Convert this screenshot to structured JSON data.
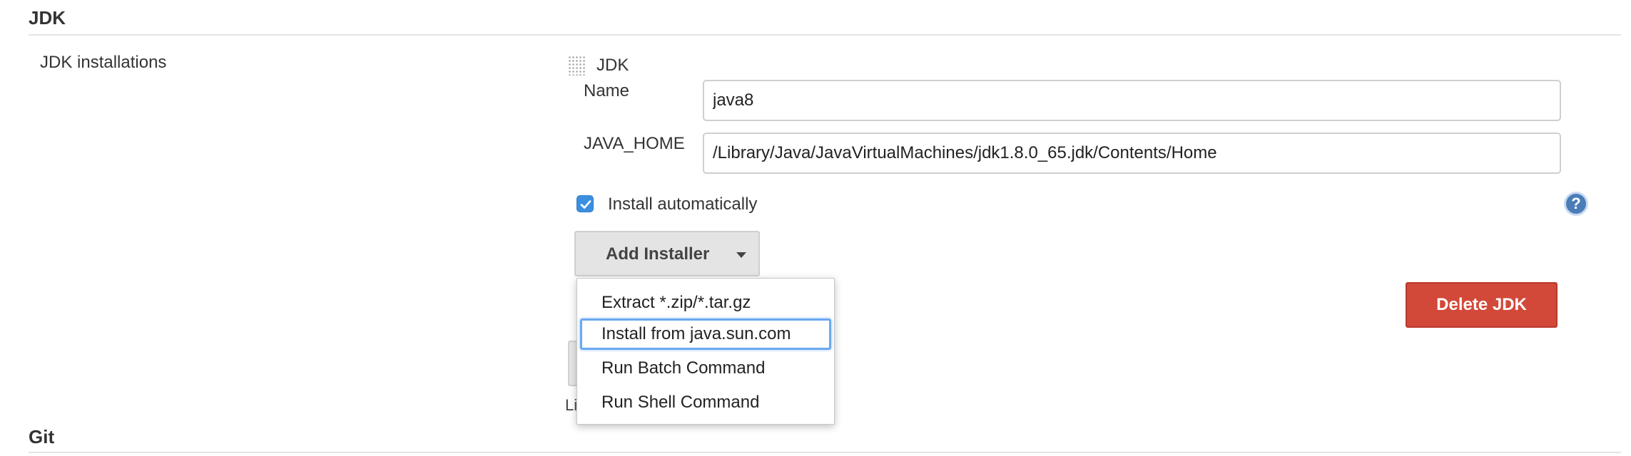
{
  "sections": {
    "jdk_title": "JDK",
    "git_title": "Git"
  },
  "jdk": {
    "installations_label": "JDK installations",
    "item_title": "JDK",
    "name_label": "Name",
    "name_value": "java8",
    "java_home_label": "JAVA_HOME",
    "java_home_value": "/Library/Java/JavaVirtualMachines/jdk1.8.0_65.jdk/Contents/Home",
    "install_auto_label": "Install automatically",
    "install_auto_checked": true,
    "help_glyph": "?",
    "add_installer_label": "Add Installer",
    "delete_label": "Delete JDK",
    "partial_text": "Li"
  },
  "dropdown": {
    "items": [
      {
        "label": "Extract *.zip/*.tar.gz"
      },
      {
        "label": "Install from java.sun.com"
      },
      {
        "label": "Run Batch Command"
      },
      {
        "label": "Run Shell Command"
      }
    ],
    "focused_index": 1
  },
  "colors": {
    "accent": "#3c8fe0",
    "danger": "#d24939",
    "focus_ring": "#6aa9f0"
  },
  "icons": {
    "drag": "drag-handle-icon",
    "check": "checkmark-icon",
    "help": "help-icon",
    "caret": "caret-down-icon"
  }
}
